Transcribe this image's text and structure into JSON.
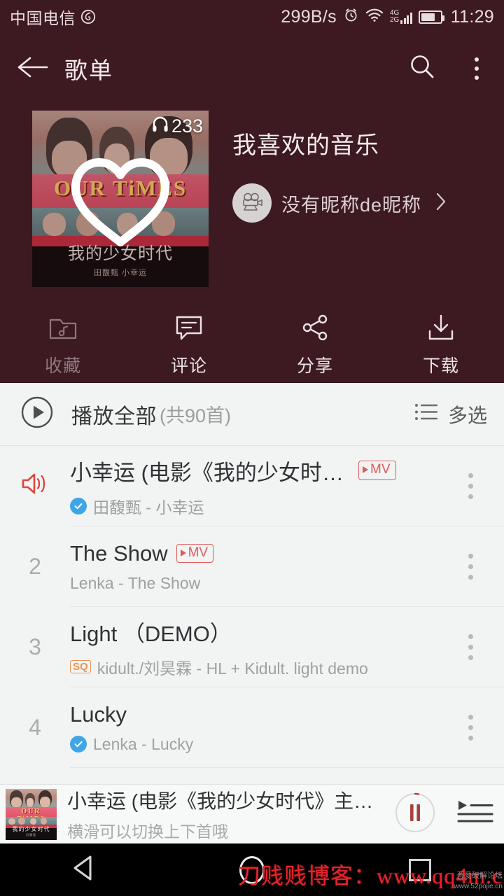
{
  "statusbar": {
    "carrier": "中国电信",
    "logo_icon": "netease-music-logo-icon",
    "network_speed": "299B/s",
    "alarm_icon": "alarm-clock-icon",
    "wifi_icon": "wifi-icon",
    "signal_label_top": "4G",
    "signal_label_bottom": "2G",
    "signal_icon": "cellular-signal-icon",
    "battery_icon": "battery-icon",
    "time": "11:29"
  },
  "appbar": {
    "back_icon": "back-arrow-icon",
    "title": "歌单",
    "search_icon": "search-icon",
    "overflow_icon": "more-vertical-icon"
  },
  "playlist": {
    "cover": {
      "poster_title_en": "OUR TiMES",
      "poster_title_cn": "我的少女时代",
      "poster_credit": "田馥甄 小幸运",
      "heart_icon": "heart-outline-icon",
      "headphone_icon": "headphone-icon",
      "play_count": "233"
    },
    "title": "我喜欢的音乐",
    "creator": {
      "avatar_icon": "movie-camera-icon",
      "name": "没有昵称de昵称",
      "chevron_icon": "chevron-right-icon"
    }
  },
  "actions": [
    {
      "icon": "folder-music-icon",
      "label": "收藏",
      "enabled": false
    },
    {
      "icon": "comment-icon",
      "label": "评论",
      "enabled": true
    },
    {
      "icon": "share-icon",
      "label": "分享",
      "enabled": true
    },
    {
      "icon": "download-icon",
      "label": "下载",
      "enabled": true
    }
  ],
  "playall": {
    "play_icon": "play-circle-icon",
    "label": "播放全部",
    "count_label": "(共90首)",
    "multiselect_icon": "list-multiselect-icon",
    "multiselect_label": "多选"
  },
  "songs": [
    {
      "index": "",
      "playing_icon": "speaker-playing-icon",
      "name": "小幸运 (电影《我的少女时代》…",
      "mv_badge": "MV",
      "has_mv": true,
      "quality_badge": "",
      "verified": true,
      "meta": "田馥甄 - 小幸运",
      "more_icon": "more-vertical-icon",
      "current": true
    },
    {
      "index": "2",
      "playing_icon": "",
      "name": "The Show",
      "mv_badge": "MV",
      "has_mv": true,
      "quality_badge": "",
      "verified": false,
      "meta": "Lenka - The Show",
      "more_icon": "more-vertical-icon",
      "current": false
    },
    {
      "index": "3",
      "playing_icon": "",
      "name": "Light （DEMO）",
      "mv_badge": "",
      "has_mv": false,
      "quality_badge": "SQ",
      "verified": false,
      "meta": "kidult./刘昊霖 - HL + Kidult. light demo",
      "more_icon": "more-vertical-icon",
      "current": false
    },
    {
      "index": "4",
      "playing_icon": "",
      "name": "Lucky",
      "mv_badge": "",
      "has_mv": false,
      "quality_badge": "",
      "verified": true,
      "meta": "Lenka - Lucky",
      "more_icon": "more-vertical-icon",
      "current": false
    }
  ],
  "player": {
    "cover_icon": "album-art-icon",
    "title": "小幸运 (电影《我的少女时代》主题曲)",
    "subtitle": "横滑可以切换上下首哦",
    "pause_icon": "pause-icon",
    "queue_icon": "play-queue-icon",
    "progress_percent": 4
  },
  "navbar": {
    "back_icon": "nav-back-triangle-icon",
    "home_icon": "nav-home-circle-icon",
    "recents_icon": "nav-recents-square-icon"
  },
  "watermark": {
    "main": "刀贱贱博客：www.qq4m.c",
    "small": "吾爱破解论坛",
    "small2": "www.52pojie.cn"
  },
  "colors": {
    "header_bg": "#3d1a22",
    "list_bg": "#f2f4f3",
    "accent_red": "#e05a5a",
    "verified_blue": "#3ea6e8",
    "sq_orange": "#e8945a"
  }
}
